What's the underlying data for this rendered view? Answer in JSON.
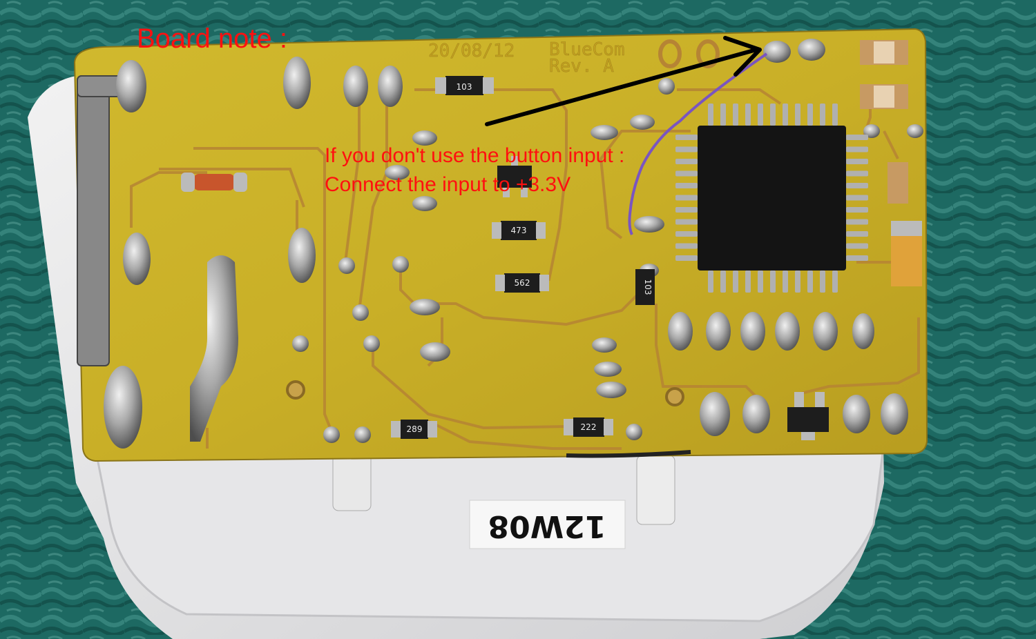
{
  "annotation": {
    "title": "Board note :",
    "line1": "If you don't use the button input :",
    "line2": "Connect the input to +3.3V",
    "color": "#ff1010",
    "arrow_color": "#000000"
  },
  "board": {
    "date": "20/08/12",
    "name": "BlueCom",
    "revision": "Rev. A",
    "pcb_color": "#c8b12a",
    "trace_color": "#b98a3c",
    "solder_color": "#b6b6b6",
    "jumper_wire_color": "#7a55c0"
  },
  "resistors": [
    "103",
    "473",
    "562",
    "103",
    "289",
    "222"
  ],
  "case_label": "12W08",
  "background_color": "#1f6b63"
}
